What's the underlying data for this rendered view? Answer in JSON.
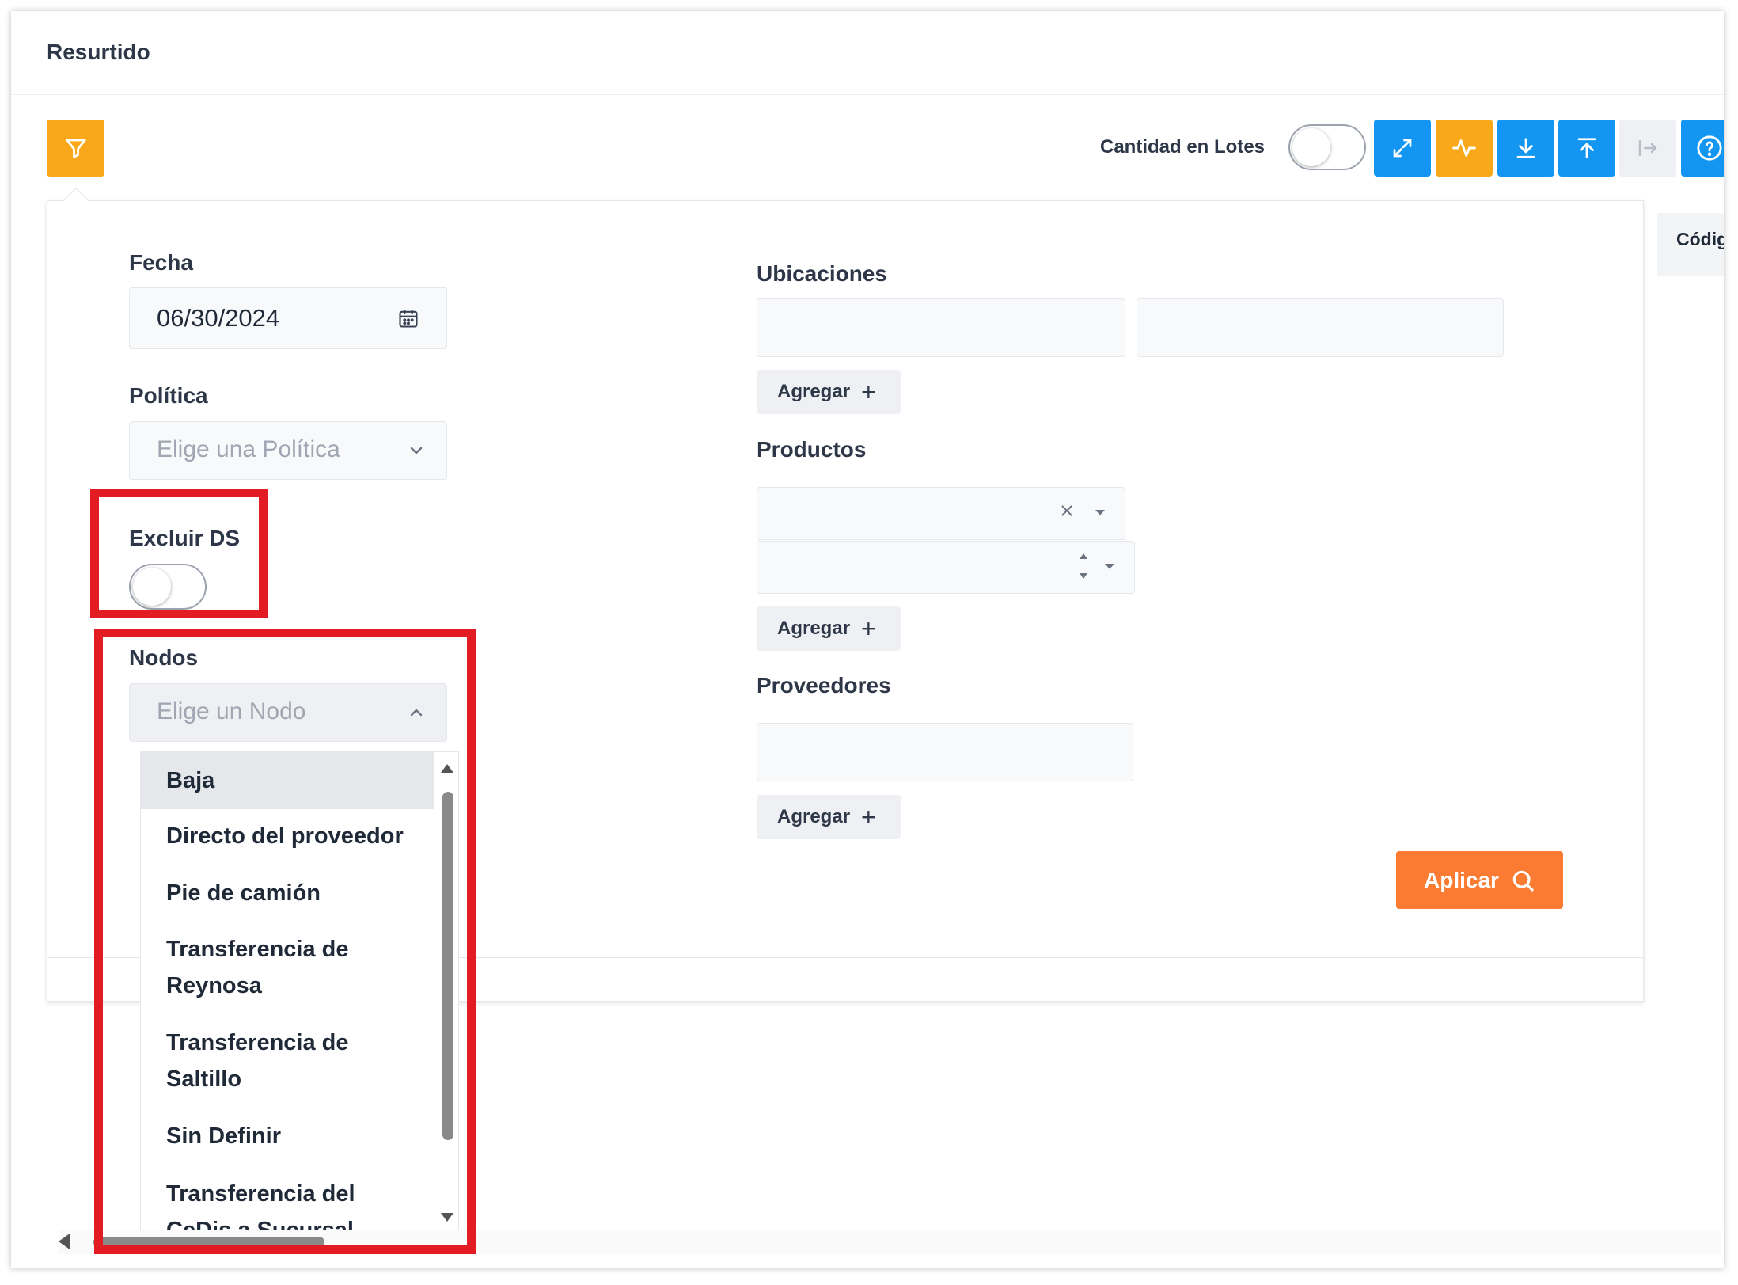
{
  "header": {
    "title": "Resurtido"
  },
  "toolbar": {
    "lotes_label": "Cantidad en Lotes",
    "lotes_toggle_on": false,
    "buttons": [
      "expand-icon",
      "activity-icon",
      "download-icon",
      "upload-icon",
      "exit-icon",
      "help-icon"
    ]
  },
  "table": {
    "column_partial": "Códig"
  },
  "filters": {
    "fecha": {
      "label": "Fecha",
      "value": "06/30/2024"
    },
    "politica": {
      "label": "Política",
      "placeholder": "Elige una Política"
    },
    "excluir_ds": {
      "label": "Excluir DS",
      "on": false
    },
    "nodos": {
      "label": "Nodos",
      "placeholder": "Elige un Nodo",
      "options": [
        "Baja",
        "Directo del proveedor",
        "Pie de camión",
        "Transferencia de Reynosa",
        "Transferencia de Saltillo",
        "Sin Definir",
        "Transferencia del CeDis a Sucursal"
      ],
      "highlighted_option": "Baja"
    },
    "ubicaciones": {
      "label": "Ubicaciones",
      "add_label": "Agregar"
    },
    "productos": {
      "label": "Productos",
      "add_label": "Agregar"
    },
    "proveedores": {
      "label": "Proveedores",
      "add_label": "Agregar"
    },
    "apply_label": "Aplicar"
  },
  "colors": {
    "orange": "#fb7b33",
    "yellow": "#f9a81a",
    "blue": "#1296f1",
    "highlight_red": "#e31b23"
  }
}
